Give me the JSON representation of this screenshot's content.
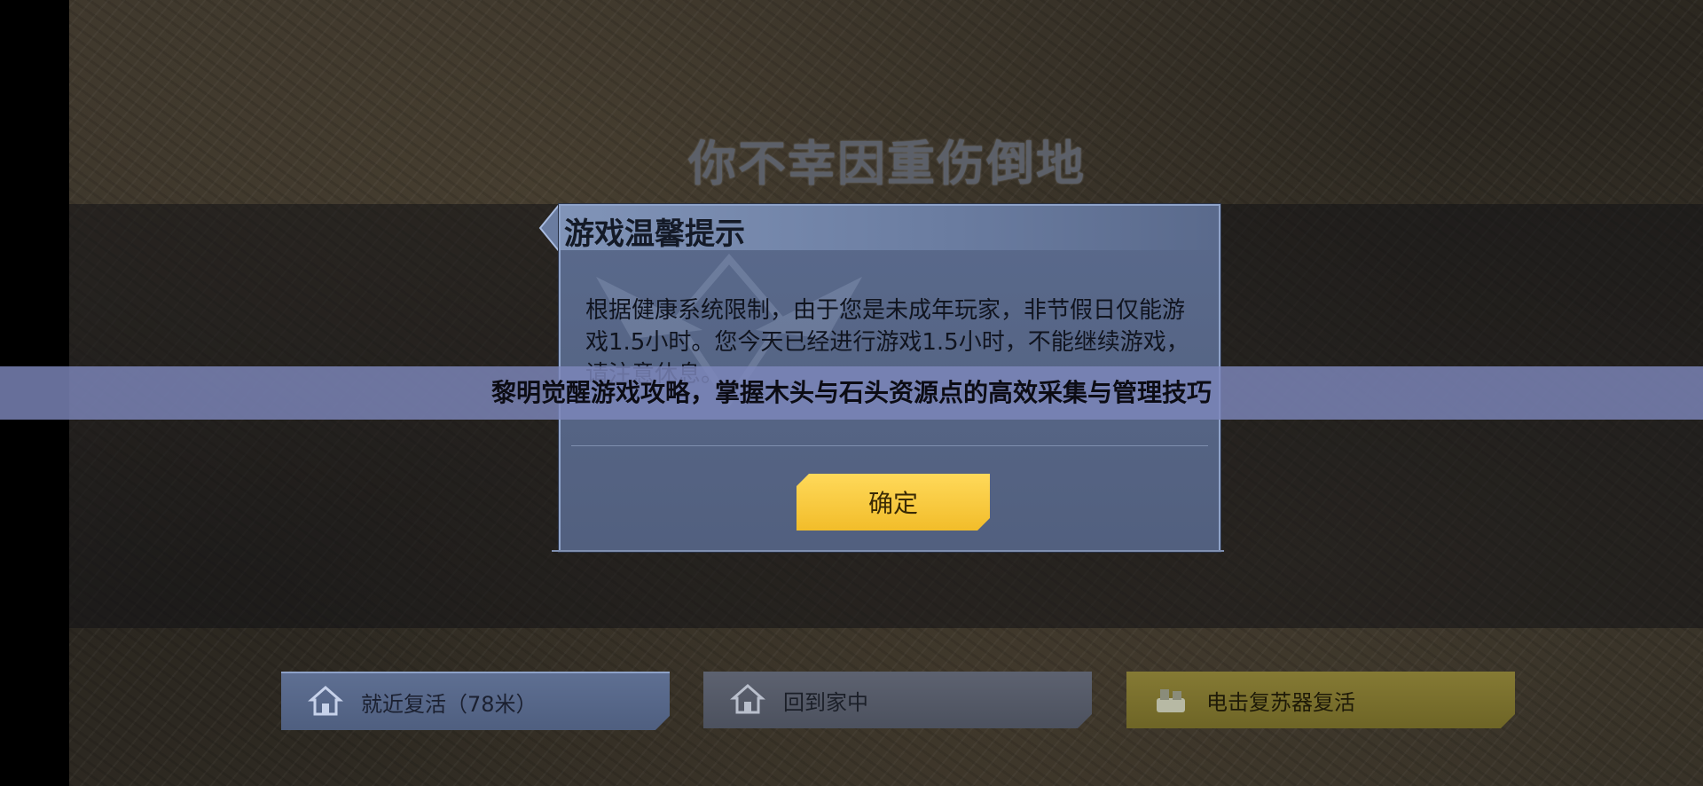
{
  "scene": {
    "downed_title": "你不幸因重伤倒地"
  },
  "dialog": {
    "title": "游戏温馨提示",
    "body": "根据健康系统限制，由于您是未成年玩家，非节假日仅能游戏1.5小时。您今天已经进行游戏1.5小时，不能继续游戏，请注意休息。",
    "confirm_label": "确定"
  },
  "banner": {
    "text": "黎明觉醒游戏攻略，掌握木头与石头资源点的高效采集与管理技巧"
  },
  "revive_options": [
    {
      "label": "就近复活（78米）",
      "icon": "house-icon"
    },
    {
      "label": "回到家中",
      "icon": "house-icon"
    },
    {
      "label": "电击复苏器复活",
      "icon": "defibrillator-icon"
    }
  ],
  "colors": {
    "dialog_bg": "#5a6a8c",
    "confirm": "#f2bd2a",
    "banner": "#7e88bc"
  }
}
